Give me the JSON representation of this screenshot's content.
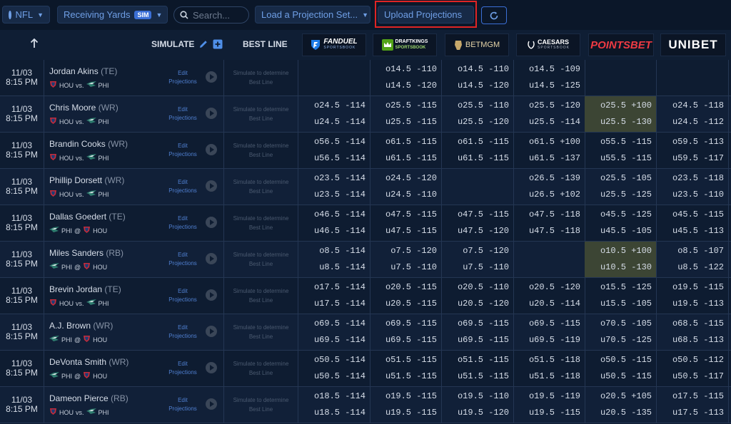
{
  "toolbar": {
    "league": "NFL",
    "market": "Receiving Yards",
    "sim_badge": "SIM",
    "search_placeholder": "Search...",
    "load_projection": "Load a Projection Set...",
    "upload_projections": "Upload Projections"
  },
  "header": {
    "simulate": "SIMULATE",
    "best_line": "BEST LINE",
    "books": [
      "FANDUEL",
      "DRAFTKINGS",
      "BETMGM",
      "CAESARS",
      "POINTSBET",
      "UNIBET"
    ],
    "fanduel_sub": "SPORTSBOOK",
    "draftkings_sub": "SPORTSBOOK",
    "caesars_sub": "SPORTSBOOK"
  },
  "edit_label": [
    "Edit",
    "Projections"
  ],
  "best_placeholder": [
    "Simulate to determine",
    "Best Line"
  ],
  "colors": {
    "accent": "#3b6fd6",
    "highlight": "#3c4534",
    "red_box": "#e02424"
  },
  "rows": [
    {
      "date": "11/03",
      "time": "8:15 PM",
      "name": "Jordan Akins",
      "pos": "(TE)",
      "team": "HOU",
      "sep": "vs.",
      "opp": "PHI",
      "odds": [
        [
          "",
          ""
        ],
        [
          "o14.5 -110",
          "u14.5 -120"
        ],
        [
          "o14.5 -110",
          "u14.5 -120"
        ],
        [
          "o14.5 -109",
          "u14.5 -125"
        ],
        [
          "",
          ""
        ],
        [
          "",
          ""
        ]
      ]
    },
    {
      "date": "11/03",
      "time": "8:15 PM",
      "name": "Chris Moore",
      "pos": "(WR)",
      "team": "HOU",
      "sep": "vs.",
      "opp": "PHI",
      "odds": [
        [
          "o24.5 -114",
          "u24.5 -114"
        ],
        [
          "o25.5 -115",
          "u25.5 -115"
        ],
        [
          "o25.5 -110",
          "u25.5 -120"
        ],
        [
          "o25.5 -120",
          "u25.5 -114"
        ],
        [
          "o25.5 +100",
          "u25.5 -130"
        ],
        [
          "o24.5 -118",
          "u24.5 -112"
        ]
      ],
      "hl": [
        4
      ]
    },
    {
      "date": "11/03",
      "time": "8:15 PM",
      "name": "Brandin Cooks",
      "pos": "(WR)",
      "team": "HOU",
      "sep": "vs.",
      "opp": "PHI",
      "odds": [
        [
          "o56.5 -114",
          "u56.5 -114"
        ],
        [
          "o61.5 -115",
          "u61.5 -115"
        ],
        [
          "o61.5 -115",
          "u61.5 -115"
        ],
        [
          "o61.5 +100",
          "u61.5 -137"
        ],
        [
          "o55.5 -115",
          "u55.5 -115"
        ],
        [
          "o59.5 -113",
          "u59.5 -117"
        ]
      ]
    },
    {
      "date": "11/03",
      "time": "8:15 PM",
      "name": "Phillip Dorsett",
      "pos": "(WR)",
      "team": "HOU",
      "sep": "vs.",
      "opp": "PHI",
      "odds": [
        [
          "o23.5 -114",
          "u23.5 -114"
        ],
        [
          "o24.5 -120",
          "u24.5 -110"
        ],
        [
          "",
          ""
        ],
        [
          "o26.5 -139",
          "u26.5 +102"
        ],
        [
          "o25.5 -105",
          "u25.5 -125"
        ],
        [
          "o23.5 -118",
          "u23.5 -110"
        ]
      ]
    },
    {
      "date": "11/03",
      "time": "8:15 PM",
      "name": "Dallas Goedert",
      "pos": "(TE)",
      "team": "PHI",
      "sep": "@",
      "opp": "HOU",
      "odds": [
        [
          "o46.5 -114",
          "u46.5 -114"
        ],
        [
          "o47.5 -115",
          "u47.5 -115"
        ],
        [
          "o47.5 -115",
          "u47.5 -120"
        ],
        [
          "o47.5 -118",
          "u47.5 -118"
        ],
        [
          "o45.5 -125",
          "u45.5 -105"
        ],
        [
          "o45.5 -115",
          "u45.5 -113"
        ]
      ]
    },
    {
      "date": "11/03",
      "time": "8:15 PM",
      "name": "Miles Sanders",
      "pos": "(RB)",
      "team": "PHI",
      "sep": "@",
      "opp": "HOU",
      "odds": [
        [
          "o8.5 -114",
          "u8.5 -114"
        ],
        [
          "o7.5 -120",
          "u7.5 -110"
        ],
        [
          "o7.5 -120",
          "u7.5 -110"
        ],
        [
          "",
          ""
        ],
        [
          "o10.5 +100",
          "u10.5 -130"
        ],
        [
          "o8.5 -107",
          "u8.5 -122"
        ]
      ],
      "hl": [
        4
      ]
    },
    {
      "date": "11/03",
      "time": "8:15 PM",
      "name": "Brevin Jordan",
      "pos": "(TE)",
      "team": "HOU",
      "sep": "vs.",
      "opp": "PHI",
      "odds": [
        [
          "o17.5 -114",
          "u17.5 -114"
        ],
        [
          "o20.5 -115",
          "u20.5 -115"
        ],
        [
          "o20.5 -110",
          "u20.5 -120"
        ],
        [
          "o20.5 -120",
          "u20.5 -114"
        ],
        [
          "o15.5 -125",
          "u15.5 -105"
        ],
        [
          "o19.5 -115",
          "u19.5 -113"
        ]
      ]
    },
    {
      "date": "11/03",
      "time": "8:15 PM",
      "name": "A.J. Brown",
      "pos": "(WR)",
      "team": "PHI",
      "sep": "@",
      "opp": "HOU",
      "odds": [
        [
          "o69.5 -114",
          "u69.5 -114"
        ],
        [
          "o69.5 -115",
          "u69.5 -115"
        ],
        [
          "o69.5 -115",
          "u69.5 -115"
        ],
        [
          "o69.5 -115",
          "u69.5 -119"
        ],
        [
          "o70.5 -105",
          "u70.5 -125"
        ],
        [
          "o68.5 -115",
          "u68.5 -113"
        ]
      ]
    },
    {
      "date": "11/03",
      "time": "8:15 PM",
      "name": "DeVonta Smith",
      "pos": "(WR)",
      "team": "PHI",
      "sep": "@",
      "opp": "HOU",
      "odds": [
        [
          "o50.5 -114",
          "u50.5 -114"
        ],
        [
          "o51.5 -115",
          "u51.5 -115"
        ],
        [
          "o51.5 -115",
          "u51.5 -115"
        ],
        [
          "o51.5 -118",
          "u51.5 -118"
        ],
        [
          "o50.5 -115",
          "u50.5 -115"
        ],
        [
          "o50.5 -112",
          "u50.5 -117"
        ]
      ]
    },
    {
      "date": "11/03",
      "time": "8:15 PM",
      "name": "Dameon Pierce",
      "pos": "(RB)",
      "team": "HOU",
      "sep": "vs.",
      "opp": "PHI",
      "odds": [
        [
          "o18.5 -114",
          "u18.5 -114"
        ],
        [
          "o19.5 -115",
          "u19.5 -115"
        ],
        [
          "o19.5 -110",
          "u19.5 -120"
        ],
        [
          "o19.5 -119",
          "u19.5 -115"
        ],
        [
          "o20.5 +105",
          "u20.5 -135"
        ],
        [
          "o17.5 -115",
          "u17.5 -113"
        ]
      ]
    }
  ]
}
